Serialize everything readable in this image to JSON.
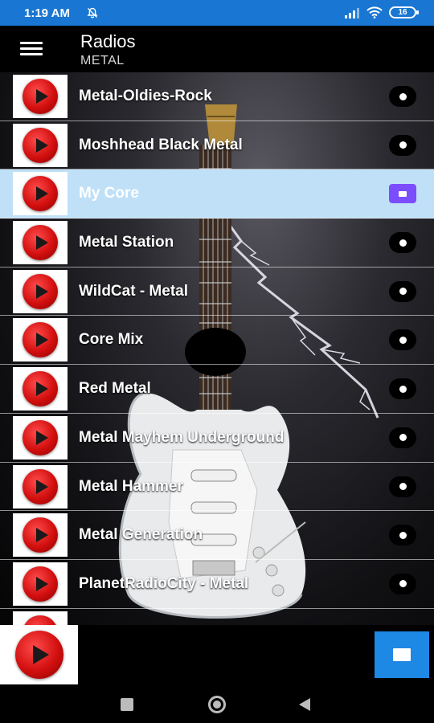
{
  "status_bar": {
    "time": "1:19 AM",
    "battery": "16",
    "icons": [
      "bell-off-icon",
      "signal-icon",
      "wifi-icon",
      "battery-icon"
    ]
  },
  "app_bar": {
    "title": "Radios",
    "subtitle": "METAL",
    "menu_icon": "hamburger-menu-icon"
  },
  "stations": [
    {
      "name": "Metal-Oldies-Rock",
      "action_icon": "dot-icon"
    },
    {
      "name": "Moshhead Black Metal",
      "action_icon": "dot-icon"
    },
    {
      "name": "My Core",
      "action_icon": "stop-icon",
      "active": true
    },
    {
      "name": "Metal Station",
      "action_icon": "dot-icon"
    },
    {
      "name": "WildCat - Metal",
      "action_icon": "dot-icon"
    },
    {
      "name": "Core Mix",
      "action_icon": "dot-icon"
    },
    {
      "name": "Red Metal",
      "action_icon": "dot-icon"
    },
    {
      "name": "Metal Mayhem Underground",
      "action_icon": "dot-icon"
    },
    {
      "name": "Metal Hammer",
      "action_icon": "dot-icon"
    },
    {
      "name": "Metal Generation",
      "action_icon": "dot-icon"
    },
    {
      "name": "PlanetRadioCity - Metal",
      "action_icon": "dot-icon"
    }
  ],
  "player": {
    "logo_icon": "play-icon",
    "stop_icon": "stop-icon"
  },
  "nav_bar": {
    "icons": [
      "recents-icon",
      "home-icon",
      "back-icon"
    ]
  },
  "colors": {
    "status_bar": "#1976d2",
    "active_row": "#bfe0f7",
    "active_stop": "#7c4dff",
    "stop_button": "#1e88e5",
    "play_red": "#d20f0f"
  }
}
